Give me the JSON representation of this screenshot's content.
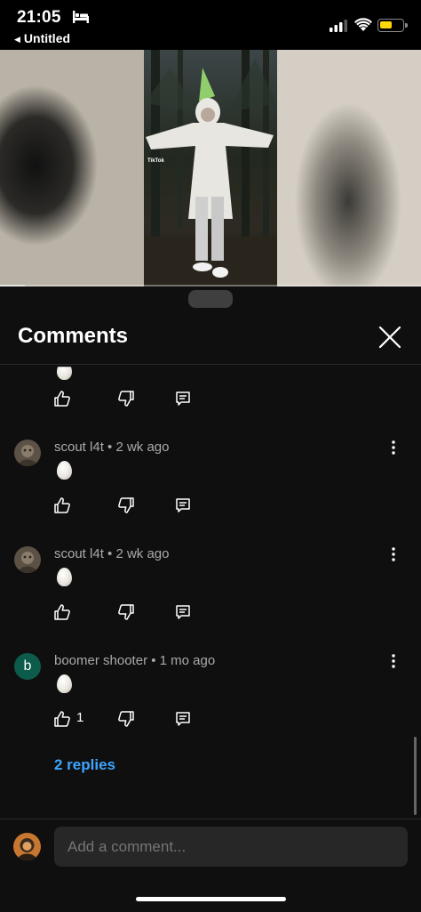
{
  "status_bar": {
    "time": "21:05",
    "back_app": "Untitled",
    "icons": [
      "bed-icon",
      "signal-icon",
      "wifi-icon",
      "battery-icon"
    ],
    "battery_color": "#ffd60a"
  },
  "video": {
    "watermark": "TikTok",
    "progress_fraction": 0.06
  },
  "sheet": {
    "title": "Comments",
    "close_icon": "close-icon"
  },
  "comments": [
    {
      "author": "scout l4t",
      "age": "2 wk ago",
      "meta": "scout l4t • 2 wk ago",
      "text_emoji": "egg-emoji",
      "likes": ""
    },
    {
      "author": "scout l4t",
      "age": "2 wk ago",
      "meta": "scout l4t • 2 wk ago",
      "text_emoji": "egg-emoji",
      "likes": ""
    },
    {
      "author": "boomer shooter",
      "age": "1 mo ago",
      "meta": "boomer shooter • 1 mo ago",
      "avatar_letter": "b",
      "text_emoji": "egg-emoji",
      "likes": "1"
    }
  ],
  "replies_link": "2 replies",
  "composer": {
    "placeholder": "Add a comment..."
  },
  "colors": {
    "background": "#0f0f0f",
    "link": "#3ea6ff",
    "input_bg": "#272727",
    "avatar_b_bg": "#0d5b4b"
  }
}
